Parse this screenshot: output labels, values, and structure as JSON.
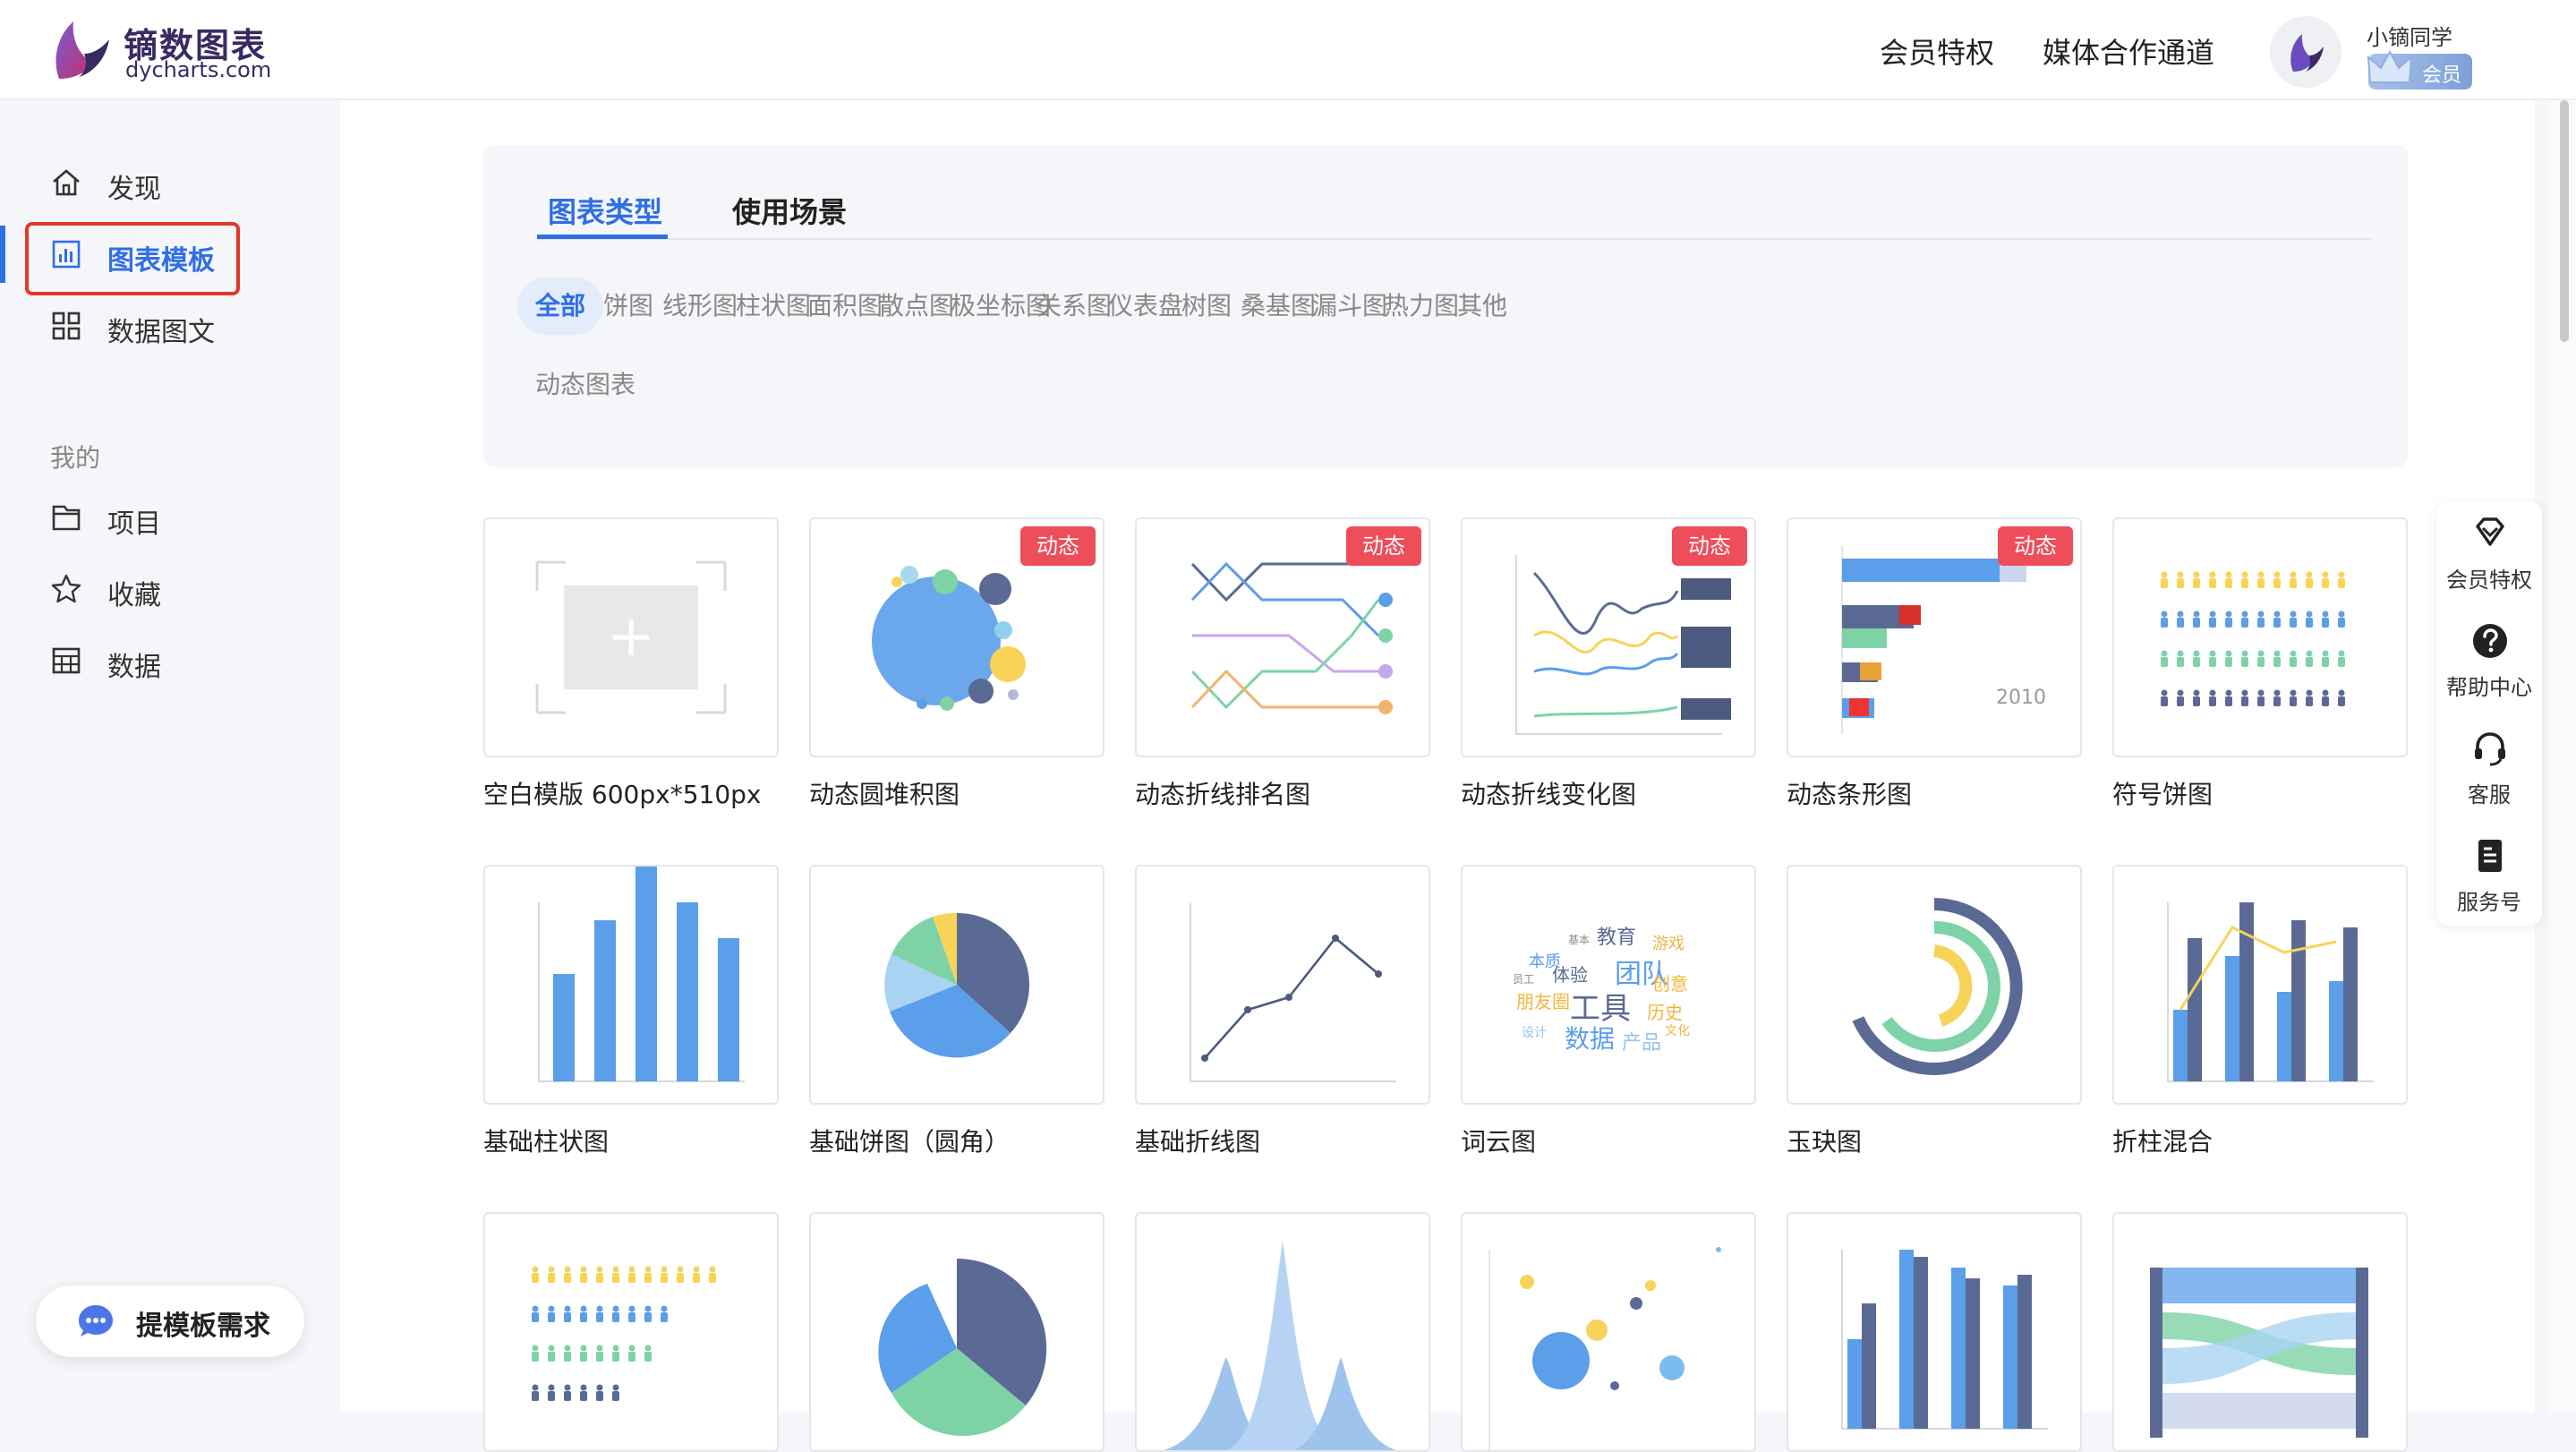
{
  "brand": {
    "name": "镝数图表",
    "domain": "dycharts.com"
  },
  "header": {
    "nav": [
      {
        "label": "会员特权"
      },
      {
        "label": "媒体合作通道"
      }
    ],
    "user": {
      "name": "小镝同学",
      "badge": "会员"
    }
  },
  "sidebar": {
    "items": [
      {
        "label": "发现",
        "icon": "home-icon"
      },
      {
        "label": "图表模板",
        "icon": "chart-template-icon",
        "active": true
      },
      {
        "label": "数据图文",
        "icon": "grid-icon"
      }
    ],
    "section_title": "我的",
    "my_items": [
      {
        "label": "项目",
        "icon": "folder-icon"
      },
      {
        "label": "收藏",
        "icon": "star-icon"
      },
      {
        "label": "数据",
        "icon": "table-icon"
      }
    ],
    "request_button": "提模板需求"
  },
  "filters": {
    "tabs": [
      {
        "label": "图表类型",
        "active": true
      },
      {
        "label": "使用场景"
      }
    ],
    "chips": [
      "全部",
      "饼图",
      "线形图",
      "柱状图",
      "面积图",
      "散点图",
      "极坐标图",
      "关系图",
      "仪表盘",
      "树图",
      "桑基图",
      "漏斗图",
      "热力图",
      "其他",
      "动态图表"
    ],
    "active_chip": "全部"
  },
  "templates": [
    {
      "title": "空白模版 600px*510px",
      "thumb": "blank"
    },
    {
      "title": "动态圆堆积图",
      "tag": "动态",
      "thumb": "circle-pack"
    },
    {
      "title": "动态折线排名图",
      "tag": "动态",
      "thumb": "bump-line"
    },
    {
      "title": "动态折线变化图",
      "tag": "动态",
      "thumb": "line-change"
    },
    {
      "title": "动态条形图",
      "tag": "动态",
      "thumb": "bar-race",
      "thumb_text": "2010"
    },
    {
      "title": "符号饼图",
      "thumb": "pictogram"
    },
    {
      "title": "基础柱状图",
      "thumb": "bar"
    },
    {
      "title": "基础饼图（圆角）",
      "thumb": "pie"
    },
    {
      "title": "基础折线图",
      "thumb": "line"
    },
    {
      "title": "词云图",
      "thumb": "wordcloud",
      "words": [
        "教育",
        "游戏",
        "本质",
        "基本",
        "体验",
        "团队",
        "创意",
        "朋友圈",
        "工具",
        "历史",
        "设计",
        "数据",
        "产品",
        "文化",
        "员工"
      ]
    },
    {
      "title": "玉玦图",
      "thumb": "radial-bar"
    },
    {
      "title": "折柱混合",
      "thumb": "bar-line"
    },
    {
      "title": "",
      "thumb": "pictogram-2"
    },
    {
      "title": "",
      "thumb": "rose-pie"
    },
    {
      "title": "",
      "thumb": "peak-area"
    },
    {
      "title": "",
      "thumb": "bubble"
    },
    {
      "title": "",
      "thumb": "grouped-bar"
    },
    {
      "title": "",
      "thumb": "sankey"
    }
  ],
  "float_bar": [
    {
      "label": "会员特权",
      "icon": "diamond-icon"
    },
    {
      "label": "帮助中心",
      "icon": "help-icon"
    },
    {
      "label": "客服",
      "icon": "headset-icon"
    },
    {
      "label": "服务号",
      "icon": "document-icon"
    }
  ],
  "colors": {
    "accent": "#2f6fe6",
    "tag": "#ee4d5a",
    "highlight_box": "#e2372b",
    "navy": "#5a6a94",
    "blue": "#5b9ee9",
    "yellow": "#f7d35a",
    "green": "#7dd3a5"
  }
}
